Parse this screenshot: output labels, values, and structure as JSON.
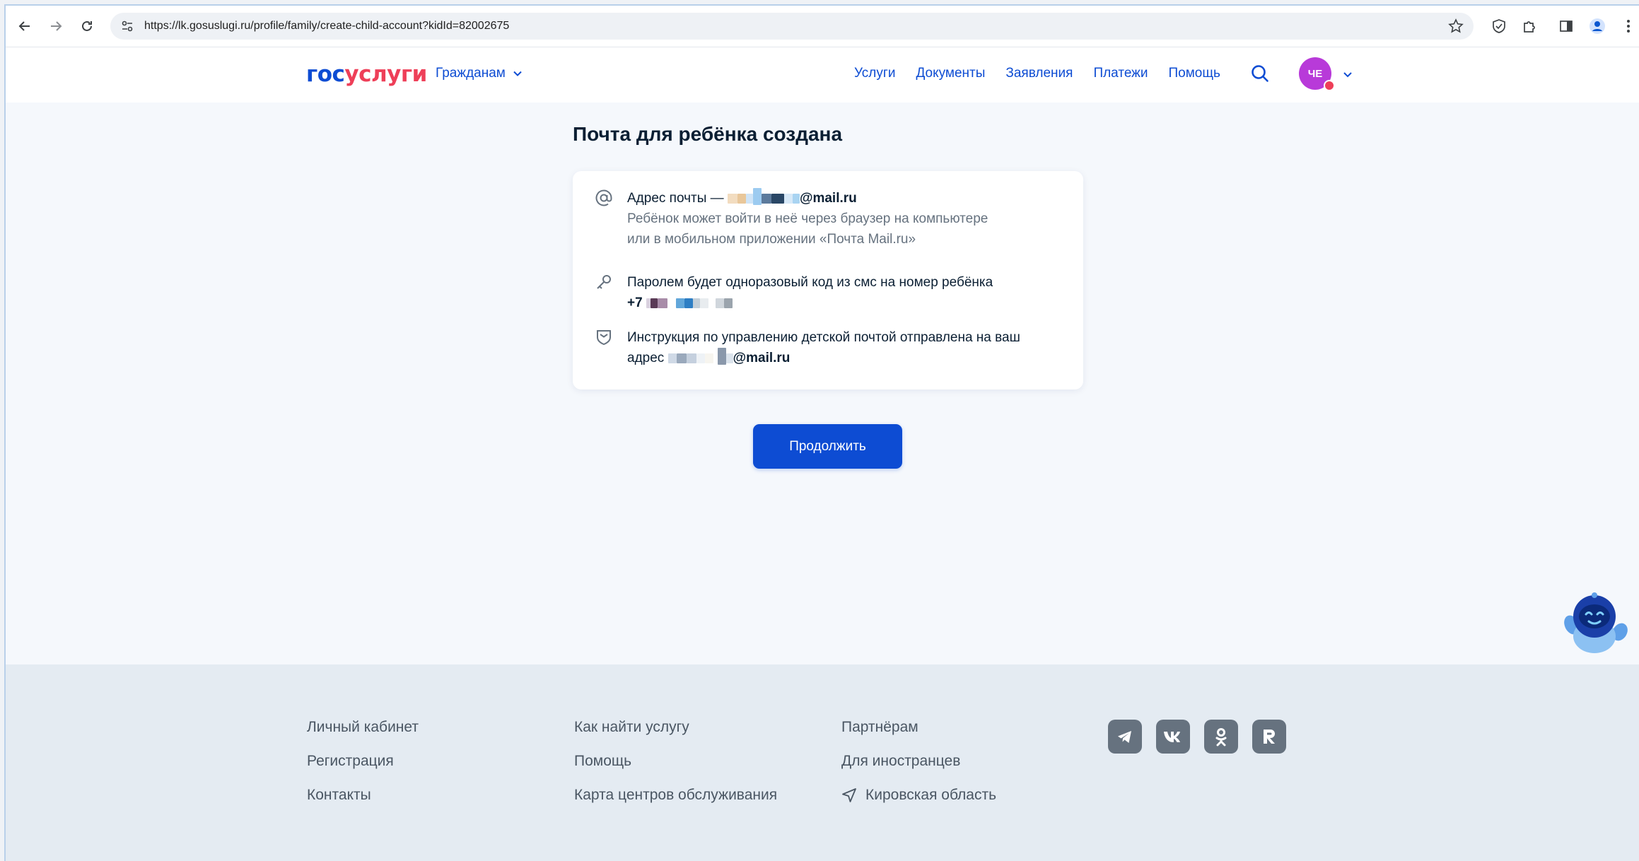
{
  "browser": {
    "url": "https://lk.gosuslugi.ru/profile/family/create-child-account?kidId=82002675"
  },
  "header": {
    "logo_part1": "гос",
    "logo_part2": "услуги",
    "audience": "Гражданам",
    "nav": [
      "Услуги",
      "Документы",
      "Заявления",
      "Платежи",
      "Помощь"
    ],
    "avatar_initials": "ЧЕ"
  },
  "main": {
    "title": "Почта для ребёнка создана",
    "card": {
      "email_label": "Адрес почты —",
      "email_domain": "@mail.ru",
      "email_note_line1": "Ребёнок может войти в неё через браузер на компьютере",
      "email_note_line2": "или в мобильном приложении «Почта Mail.ru»",
      "password_text": "Паролем будет одноразовый код из смс на номер ребёнка",
      "phone_prefix": "+7",
      "instruction_line1": "Инструкция по управлению детской почтой отправлена на ваш",
      "instruction_line2_prefix": "адрес",
      "instruction_domain": "@mail.ru"
    },
    "continue_label": "Продолжить"
  },
  "footer": {
    "col1": [
      "Личный кабинет",
      "Регистрация",
      "Контакты"
    ],
    "col2": [
      "Как найти услугу",
      "Помощь",
      "Карта центров обслуживания"
    ],
    "col3": [
      "Партнёрам",
      "Для иностранцев"
    ],
    "region": "Кировская область",
    "socials": [
      "telegram-icon",
      "vk-icon",
      "odnoklassniki-icon",
      "rutube-icon"
    ]
  },
  "colors": {
    "brand_blue": "#0d4cd3",
    "brand_red": "#ee3f58",
    "avatar": "#b83ad9"
  }
}
